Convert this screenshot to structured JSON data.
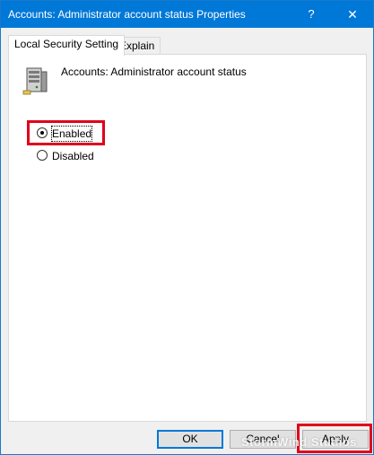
{
  "window": {
    "title": "Accounts: Administrator account status Properties",
    "help_label": "?",
    "close_label": "✕"
  },
  "tabs": [
    {
      "label": "Local Security Setting",
      "active": true
    },
    {
      "label": "Explain",
      "active": false
    }
  ],
  "policy": {
    "icon": "server-icon",
    "title": "Accounts: Administrator account status"
  },
  "options": {
    "enabled_label": "Enabled",
    "disabled_label": "Disabled",
    "selected": "Enabled"
  },
  "buttons": {
    "ok_label": "OK",
    "cancel_label": "Cancel",
    "apply_label": "Apply"
  },
  "colors": {
    "titlebar": "#0078d7",
    "highlight": "#e0001b"
  },
  "watermark": "StormWind Studios"
}
